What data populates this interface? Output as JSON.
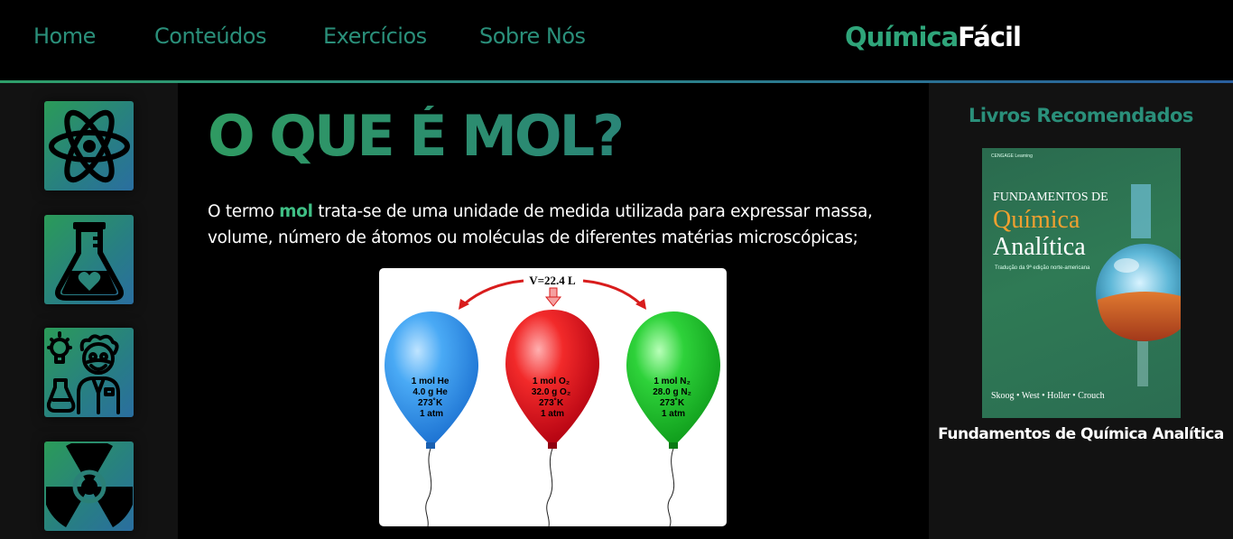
{
  "nav": {
    "items": [
      {
        "label": "Home"
      },
      {
        "label": "Conteúdos"
      },
      {
        "label": "Exercícios"
      },
      {
        "label": "Sobre Nós"
      }
    ],
    "brand_part1": "Química",
    "brand_part2": "Fácil",
    "accent_color": "#2a8f7a"
  },
  "sidebar": {
    "icons": [
      {
        "name": "atom-icon"
      },
      {
        "name": "flask-heart-icon"
      },
      {
        "name": "scientist-icon"
      },
      {
        "name": "radiation-icon"
      }
    ]
  },
  "main": {
    "title": "O QUE É MOL?",
    "intro_before": "O termo ",
    "intro_highlight": "mol",
    "intro_after": " trata-se de uma unidade de medida utilizada para expressar massa, volume, número de átomos ou moléculas de diferentes matérias microscópicas;",
    "figure": {
      "volume_label": "V=22.4 L",
      "balloons": [
        {
          "lines": [
            "1 mol He",
            "4.0 g He",
            "273˚K",
            "1 atm"
          ],
          "color": "#3fa9f5"
        },
        {
          "lines": [
            "1 mol O₂",
            "32.0 g O₂",
            "273˚K",
            "1 atm"
          ],
          "color": "#f0202a"
        },
        {
          "lines": [
            "1 mol N₂",
            "28.0 g N₂",
            "273˚K",
            "1 atm"
          ],
          "color": "#21c92a"
        }
      ]
    }
  },
  "right": {
    "title": "Livros Recomendados",
    "book": {
      "publisher": "CENGAGE Learning",
      "title_line1": "FUNDAMENTOS DE",
      "title_line2": "Química",
      "title_line3": "Analítica",
      "subtitle": "Tradução da 9ª edição norte-americana",
      "authors": "Skoog • West • Holler • Crouch"
    },
    "caption": "Fundamentos de Química Analítica"
  }
}
